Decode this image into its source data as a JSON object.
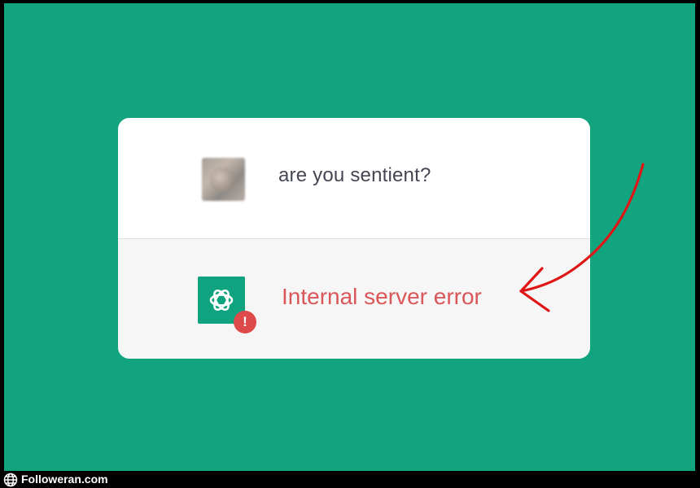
{
  "conversation": {
    "user_message": "are you sentient?",
    "assistant_error": "Internal server error",
    "error_badge": "!"
  },
  "icons": {
    "avatar": "user-avatar-icon",
    "assistant": "chatgpt-logo-icon",
    "badge": "error-badge-icon",
    "annotation": "red-arrow-icon",
    "footer": "globe-icon"
  },
  "colors": {
    "background": "#12a37f",
    "card": "#ffffff",
    "assistant_row": "#f6f6f6",
    "user_text": "#444654",
    "error_text": "#d95659",
    "badge": "#de4a4a",
    "arrow": "#e01616"
  },
  "footer": {
    "brand": "Followeran.com"
  }
}
